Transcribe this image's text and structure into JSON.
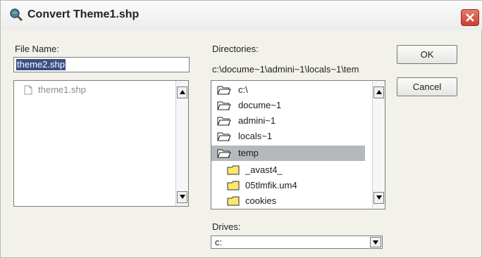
{
  "window": {
    "title": "Convert Theme1.shp"
  },
  "file_name": {
    "label": "File Name:",
    "value": "theme2.shp",
    "files": [
      "theme1.shp"
    ]
  },
  "directories": {
    "label": "Directories:",
    "current_path": "c:\\docume~1\\admini~1\\locals~1\\tem",
    "items": [
      {
        "label": "c:\\",
        "type": "open-folder"
      },
      {
        "label": "docume~1",
        "type": "open-folder"
      },
      {
        "label": "admini~1",
        "type": "open-folder"
      },
      {
        "label": "locals~1",
        "type": "open-folder"
      },
      {
        "label": "temp",
        "type": "open-folder",
        "selected": true
      },
      {
        "label": "_avast4_",
        "type": "folder"
      },
      {
        "label": "05tlmfik.um4",
        "type": "folder"
      },
      {
        "label": "cookies",
        "type": "folder"
      }
    ]
  },
  "drives": {
    "label": "Drives:",
    "value": "c:"
  },
  "buttons": {
    "ok": "OK",
    "cancel": "Cancel"
  },
  "colors": {
    "selection": "#3b4f86",
    "close_button": "#c9402c"
  }
}
